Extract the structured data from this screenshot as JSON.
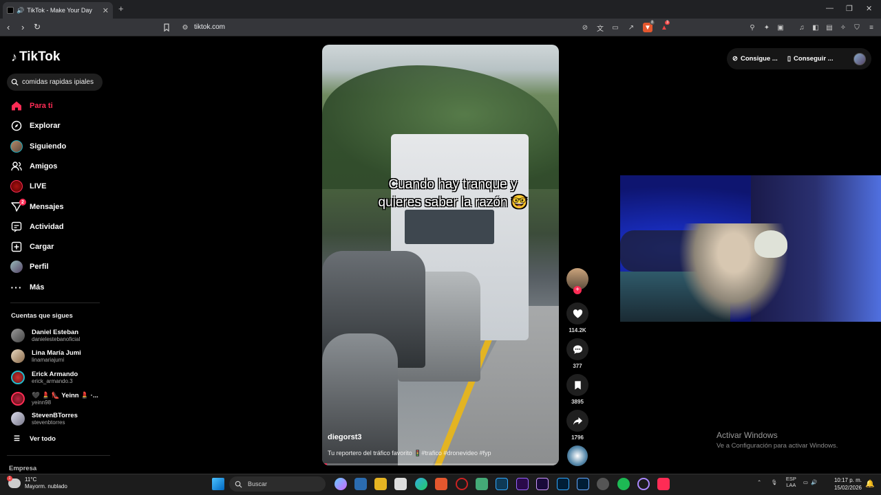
{
  "browser": {
    "tab_title": "TikTok - Make Your Day",
    "url": "tiktok.com",
    "badge_count_1": "8",
    "badge_count_2": "3"
  },
  "sidebar": {
    "brand": "TikTok",
    "search_value": "comidas rapidas ipiales",
    "nav": [
      {
        "label": "Para ti",
        "icon": "home-icon",
        "active": true
      },
      {
        "label": "Explorar",
        "icon": "compass-icon"
      },
      {
        "label": "Siguiendo",
        "icon": "following-avatar-icon"
      },
      {
        "label": "Amigos",
        "icon": "friends-icon"
      },
      {
        "label": "LIVE",
        "icon": "live-icon"
      },
      {
        "label": "Mensajes",
        "icon": "messages-icon",
        "badge": "2"
      },
      {
        "label": "Actividad",
        "icon": "activity-icon"
      },
      {
        "label": "Cargar",
        "icon": "upload-icon"
      },
      {
        "label": "Perfil",
        "icon": "profile-avatar-icon"
      },
      {
        "label": "Más",
        "icon": "more-icon"
      }
    ],
    "following_heading": "Cuentas que sigues",
    "accounts": [
      {
        "name": "Daniel Esteban",
        "handle": "danielestebanoficial"
      },
      {
        "name": "Lina María Jumi",
        "handle": "linamariajumi"
      },
      {
        "name": "Erick Armando",
        "handle": "erick_armando.3"
      },
      {
        "name": "🖤 💄 👠 Yeinn 💄 ·...",
        "handle": "yeinn98"
      },
      {
        "name": "StevenBTorres",
        "handle": "stevenbtorres"
      }
    ],
    "see_all": "Ver todo",
    "footer": "Empresa"
  },
  "video": {
    "caption_line1": "Cuando hay tranque y",
    "caption_line2": "quieres saber la razón 🤓",
    "username": "diegorst3",
    "description": "Tu reportero del tráfico favorito 🚦#trafico #dronevideo #fyp",
    "progress": 0.02
  },
  "actions": {
    "likes": "114.2K",
    "comments": "377",
    "saves": "3895",
    "shares": "1796"
  },
  "top_right": {
    "coins_label": "Consigue ...",
    "app_label": "Conseguir ..."
  },
  "watermark": {
    "line1": "Activar Windows",
    "line2": "Ve a Configuración para activar Windows."
  },
  "taskbar": {
    "temperature": "11°C",
    "weather": "Mayorm. nublado",
    "search_placeholder": "Buscar",
    "lang1": "ESP",
    "lang2": "LAA",
    "time": "10:17 p. m.",
    "date": "15/02/2026"
  },
  "colors": {
    "accent": "#fe2c55",
    "background": "#000000"
  }
}
